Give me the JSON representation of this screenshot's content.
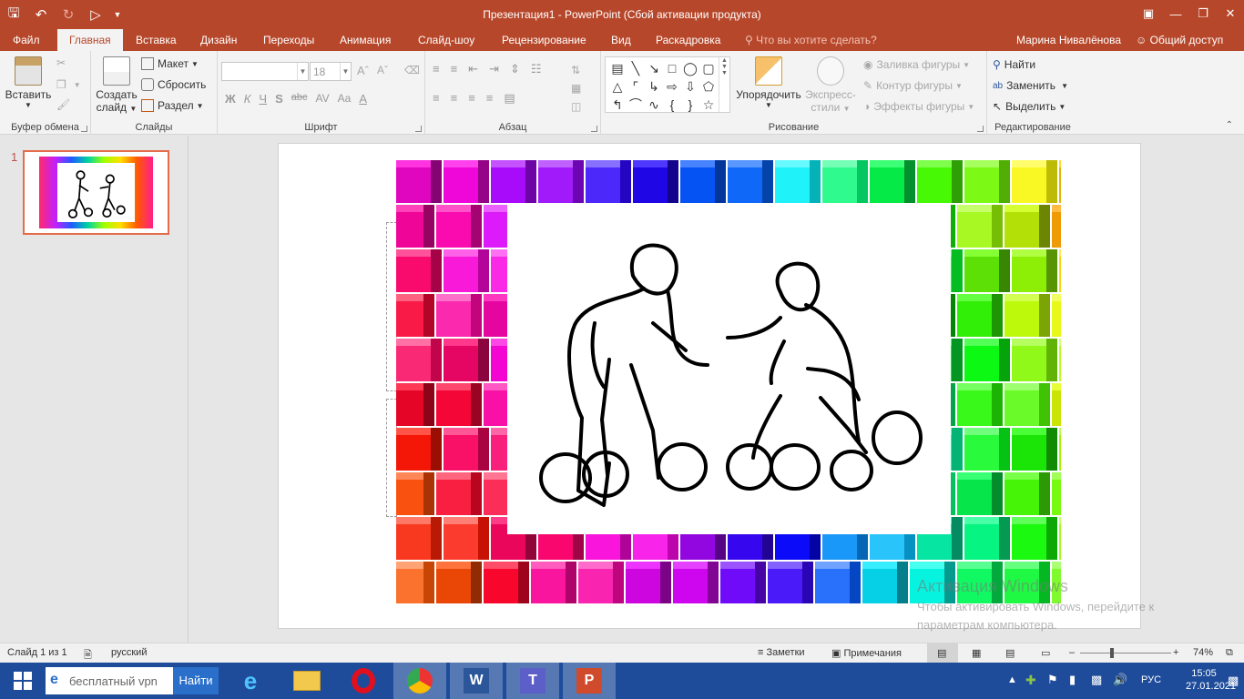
{
  "window": {
    "title": "Презентация1 - PowerPoint (Сбой активации продукта)"
  },
  "tabs": [
    {
      "label": "Файл"
    },
    {
      "label": "Главная"
    },
    {
      "label": "Вставка"
    },
    {
      "label": "Дизайн"
    },
    {
      "label": "Переходы"
    },
    {
      "label": "Анимация"
    },
    {
      "label": "Слайд-шоу"
    },
    {
      "label": "Рецензирование"
    },
    {
      "label": "Вид"
    },
    {
      "label": "Раскадровка"
    }
  ],
  "tell_me": "Что вы хотите сделать?",
  "user_name": "Марина Нивалёнова",
  "share_label": "Общий доступ",
  "ribbon": {
    "clipboard": {
      "paste": "Вставить",
      "label": "Буфер обмена"
    },
    "slides": {
      "new_slide_1": "Создать",
      "new_slide_2": "слайд",
      "layout": "Макет",
      "reset": "Сбросить",
      "section": "Раздел",
      "label": "Слайды"
    },
    "font": {
      "size": "18",
      "bold": "Ж",
      "italic": "К",
      "underline": "Ч",
      "shadow": "S",
      "strike": "abc",
      "spacing": "AV",
      "case": "Aa",
      "label": "Шрифт"
    },
    "paragraph": {
      "label": "Абзац"
    },
    "drawing": {
      "arrange": "Упорядочить",
      "styles_1": "Экспресс-",
      "styles_2": "стили",
      "fill": "Заливка фигуры",
      "outline": "Контур фигуры",
      "effects": "Эффекты фигуры",
      "label": "Рисование"
    },
    "editing": {
      "find": "Найти",
      "replace": "Заменить",
      "select": "Выделить",
      "label": "Редактирование"
    }
  },
  "thumbnail": {
    "number": "1"
  },
  "watermark": {
    "title": "Активация Windows",
    "line1": "Чтобы активировать Windows, перейдите к",
    "line2": "параметрам компьютера."
  },
  "status": {
    "slide_of": "Слайд 1 из 1",
    "language": "русский",
    "notes": "Заметки",
    "comments": "Примечания",
    "zoom": "74%"
  },
  "taskbar": {
    "search_text": "бесплатный vpn",
    "find_button": "Найти",
    "lang": "РУС",
    "time": "15:05",
    "date": "27.01.2021"
  },
  "colors": {
    "accent": "#b7472a",
    "taskbar": "#1e4c9a"
  }
}
